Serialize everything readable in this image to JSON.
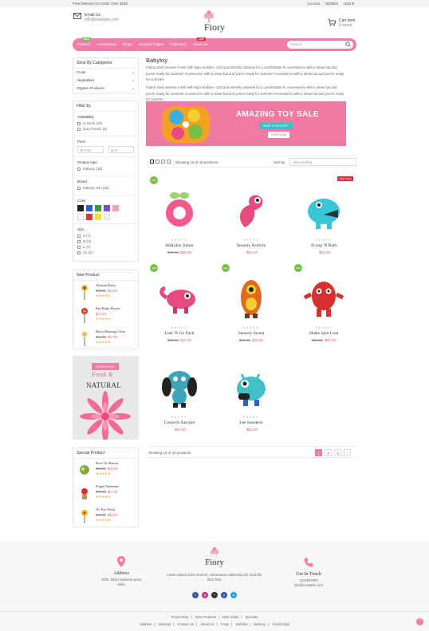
{
  "topbar": {
    "promo": "Free Delivery On Order Over $100",
    "account": "Account",
    "wishlist": "Wishlist",
    "currency": "USD $"
  },
  "header": {
    "email_label": "Email Us",
    "email_value": "info@example.com",
    "logo_text": "Fiory",
    "cart_label": "Cart item",
    "cart_count": "0 items"
  },
  "nav": {
    "items": [
      "Flowers",
      "Accessories",
      "Rings",
      "Included Pages",
      "Collection",
      "About Us"
    ],
    "badge_flowers": "NEW",
    "badge_about": "HOT",
    "search_placeholder": "Search"
  },
  "sidebar": {
    "categories_title": "Shop By Categories",
    "categories": [
      "Fruits",
      "Vegetables",
      "Organic Products"
    ],
    "filter_title": "Filter by",
    "availability_title": "Availability",
    "availability": [
      "In stock (18)",
      "Out of stock (5)"
    ],
    "price_title": "Price",
    "price_from": "From",
    "price_to": "To",
    "price_currency": "$",
    "type_title": "Product type",
    "types": [
      "babytoy (18)"
    ],
    "brand_title": "Brand",
    "brands": [
      "babytoy lem (18)"
    ],
    "color_title": "Color",
    "colors": [
      "#222222",
      "#2d62c9",
      "#3a9b3a",
      "#7a4fcf",
      "#f2a3c0",
      "#ffffff",
      "#d43a3a",
      "#f0e030",
      "#f3f3f3"
    ],
    "size_title": "Size",
    "sizes": [
      "S (7)",
      "M (3)",
      "L (7)",
      "XL (2)"
    ],
    "new_title": "New Product",
    "new_products": [
      {
        "name": "Allrium Daisy",
        "old": "$29.00",
        "price": "$24.00",
        "stars": "★★★★★"
      },
      {
        "name": "Bee Balm Flower",
        "old": "",
        "price": "$27.00",
        "stars": "★★★★★"
      },
      {
        "name": "Birch Morning Glory",
        "old": "$30.00",
        "price": "$27.00",
        "stars": "★★★★★"
      }
    ],
    "banner_btn": "SHOP NOW",
    "banner_script": "Fresh &",
    "banner_word": "NATURAL",
    "special_title": "Special Product",
    "special_products": [
      {
        "name": "Rose Of Sharon",
        "old": "$39.00",
        "price": "$35.00",
        "stars": "★★★★★"
      },
      {
        "name": "Poppy Anemone",
        "old": "$60.00",
        "price": "$57.00",
        "stars": "★★★★★"
      },
      {
        "name": "Ox Eye Daisy",
        "old": "$45.00",
        "price": "$42.00",
        "stars": "★★★★★"
      }
    ]
  },
  "main": {
    "title": "Babytoy",
    "desc1": "Faded short sleeves t-shirt with high neckline. Soft and stretchy material for a comfortable fit. Accessorize with a straw hat and you're ready for summer! Accessorize with a straw hat and you're ready for summer! Accessorize with a straw hat and you're ready for summer!",
    "desc2": "Faded short sleeves t-shirt with high neckline. Soft and stretchy material for a comfortable fit. Accessorize with a straw hat and you're ready for summer! Accessorize with a straw hat and you're ready for summer! Accessorize with a straw hat and you're ready for summer...",
    "hero_title": "AMAZING TOY SALE",
    "hero_sub": "SAVE TO 50% OFF",
    "hero_btn": "SHOP NOW",
    "showing": "Showing 16 of 18 products",
    "sort_label": "Sort by",
    "sort_value": "Best selling",
    "products": [
      {
        "name": "Skillofun Junior",
        "old": "$70.00",
        "price": "$65.00",
        "badge": "sale",
        "color": "#f25a8e"
      },
      {
        "name": "Sensory Activity",
        "old": "",
        "price": "$50.00",
        "badge": "",
        "color": "#e84a7e"
      },
      {
        "name": "Zcoop 'N Bath",
        "old": "",
        "price": "$15.00",
        "badge": "new",
        "color": "#38c6d6"
      },
      {
        "name": "Link 'N Go Pack",
        "old": "$30.00",
        "price": "$15.00",
        "badge": "sale",
        "color": "#e84a7e"
      },
      {
        "name": "Sensory Sweet",
        "old": "$39.00",
        "price": "$29.00",
        "badge": "sale",
        "color": "#e06a20"
      },
      {
        "name": "Shake Spin Lion",
        "old": "$55.00",
        "price": "$50.00",
        "badge": "sale",
        "color": "#d83030"
      },
      {
        "name": "Corporis Suscipit",
        "old": "",
        "price": "$50.00",
        "badge": "",
        "color": "#3aa6b8"
      },
      {
        "name": "Lee Sneakers",
        "old": "",
        "price": "$50.00",
        "badge": "",
        "color": "#42c0c8"
      }
    ],
    "sale_label": "Sale",
    "new_label": "NEW SALE",
    "pages": [
      "1",
      "2",
      "3",
      "›"
    ]
  },
  "footer": {
    "address_title": "Address",
    "address_lines": [
      "4005, Silver business point",
      "India"
    ],
    "about": "Lorem ipsum dolor sit amet, consectetur malesuing elit. Duis fila floor Text.",
    "contact_title": "Get In Touch",
    "contact_lines": [
      "1234567890",
      "info@example.com"
    ],
    "socials": [
      "f",
      "ig",
      "t",
      "p",
      "yt"
    ],
    "links1": [
      "Prices Drop",
      "New Products",
      "Best Sales",
      "Specials"
    ],
    "links2": [
      "Address",
      "Sitemap",
      "Contact Us",
      "About Us",
      "FAQs",
      "Wishlist",
      "Delivery",
      "Credit Slips"
    ]
  },
  "colors": {
    "accent": "#ef7da8",
    "sale": "#74c044",
    "hot": "#e02b3a"
  }
}
